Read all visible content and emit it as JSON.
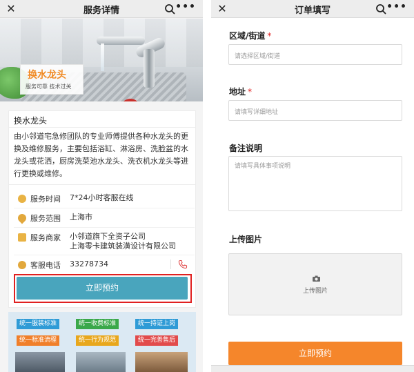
{
  "left_page": {
    "header": {
      "title": "服务详情",
      "close_icon": "close-icon",
      "search_icon": "search-icon",
      "more_icon": "more-icon"
    },
    "hero": {
      "badge_title": "换水龙头",
      "badge_sub": "服务可靠  技术过关"
    },
    "service": {
      "name": "换水龙头",
      "description": "由小邻道宅急修团队的专业师傅提供各种水龙头的更换及维修服务，主要包括浴缸、淋浴房、洗脸盆的水龙头或花洒，厨房洗菜池水龙头、洗衣机水龙头等进行更换或维修。",
      "rows": [
        {
          "label": "服务时间",
          "value": "7*24小时客服在线",
          "icon": "clock-icon"
        },
        {
          "label": "服务范围",
          "value": "上海市",
          "icon": "location-icon"
        },
        {
          "label": "服务商家",
          "value": "小邻道旗下全资子公司",
          "value2": "上海零卡建筑装潢设计有限公司",
          "icon": "shop-icon"
        },
        {
          "label": "客服电话",
          "value": "33278734",
          "icon": "phone-icon"
        }
      ],
      "book_button": "立即预约"
    },
    "tags": [
      {
        "label": "统一服装标准",
        "color": "#2f9bd6"
      },
      {
        "label": "统一收费标准",
        "color": "#3aa84a"
      },
      {
        "label": "统一持证上岗",
        "color": "#2f9bd6"
      },
      {
        "label": "统一标准流程",
        "color": "#f07f2a"
      },
      {
        "label": "统一行为规范",
        "color": "#e8a71c"
      },
      {
        "label": "统一完善售后",
        "color": "#e24b4b"
      }
    ]
  },
  "right_page": {
    "header": {
      "title": "订单填写",
      "close_icon": "close-icon",
      "search_icon": "search-icon",
      "more_icon": "more-icon"
    },
    "form": {
      "region": {
        "label": "区域/街道",
        "required": "*",
        "placeholder": "请选择区域/街道"
      },
      "address": {
        "label": "地址",
        "required": "*",
        "placeholder": "请填写详细地址"
      },
      "remarks": {
        "label": "备注说明",
        "placeholder": "请填写具体事项说明"
      },
      "upload": {
        "label": "上传图片",
        "button": "上传图片"
      },
      "submit": "立即预约"
    }
  },
  "colors": {
    "teal_button": "#49a5bd",
    "orange_button": "#f5862b",
    "required": "#e02020",
    "highlight_box": "#e02020"
  }
}
